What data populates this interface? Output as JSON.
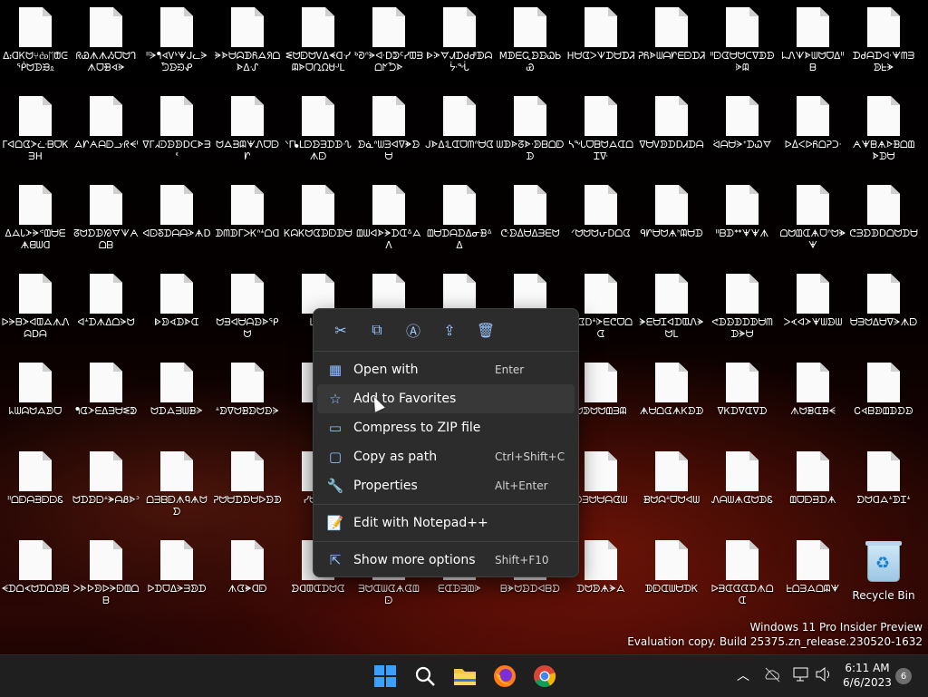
{
  "desktop": {
    "files": [
      [
        "ᐃ᎓ᗡᏦᗢ⑂ᦺᦈᛖᙧᕮᖀᗢᗬᙑᦸ",
        "ᖇᏯᗑᗑᏱᗜᗢᒉᗑᗜᙩᗏᗓ",
        "ᐦᗒᖳᗏᏙᔉᗖᒍᓚᗔᘫᗦᙌᕵ",
        "ᗓᗍᗨᗣᗫᏲᗋᖆᗝᗍᐃᔙ",
        "ᓬᗢᗟᗢᏙᐃᗛᗡᓺᗼᗎᗜᘩᘯᏌᒢᒪ",
        "ᒃᘑᐢᗓᐚᗞᕲᑦᓯᗵᗲᗝᖼᘪᗍ",
        "ᐈᗈᗊᗂᗪᑯᒇᗫᗣᔼᖔ",
        "MᗫᗴᏩᗦᗦᏇᏏᏯ",
        "HᗨᗧᐳᗐᗪᗨᗪᏘ",
        "ᕈᏲᗎᗯᗩᗁᗴᗠᗪᏘ",
        "ᐦᗠᗧᗨᗢᑕᐁᗫᗦᗇᗼ",
        "ᖺᏁᗐᗍᗯᗢᗜᐃᐦᗷ",
        "ᗪᑰᗩᗪᐚᗖᗰᗱᗥᖶᗘ"
      ],
      [
        "ᒦᐊᗝᗧᗆᓩᗷᗜᏦᗱH",
        "ᗋᗁᗅᗩᗟᓣᖇᗕᑊ",
        "ᐁᒥᖽᑓᗦᗥᗞᑕᗍᗱᓫ",
        "ᗢᗋᗲᗼᗖᏁᗜᗠᗁ",
        "ᐠᒥᖲᒪᗠᗦᗳᗪᗬᔗᗑᗠ",
        "ᗦᓈᐢᗯᗳᐊᐁᗙᗦᗨ",
        "ᒍᗍᐃᒺᗭᗜᗰᐢᗨᗧ",
        "ᗯᗫᗎᘔᗍᐧᗥᗹᗝᗟᗬ",
        "ᓵᖔᗜᗷᗢᗋᗭᗝᏆᐍ",
        "ᐁᗨᏙᗥᗪᗞᏗᗪᗩ",
        "ᐛᗩᗨᗔᕀᗪᏇᗊ",
        "ᐅᐂᐸᐅᏲᗝᕉᑐᐧ",
        "ᗅᗖᗸᗗᗌᗿᗝᗶᗍᗬᗨ"
      ],
      [
        "ᐃᗋᏓᗆᗓᕝᗶᗨᗴᗗᗺᗯᗡ",
        "ᘔᗢᗤᗬᘞᗊᗐᗅᗝᗹ",
        "ᐊᗠᘕᗪᗩᗩᗈᗗᗞ",
        "ᗫᗰᗫᒥᐳᏦᐢᗮᗝᗡ",
        "ᏦᗣᏦᗢᗧᗬᗟᗫᗨ",
        "ᗶᗯᐊᗍᗘᗪᗭᐞᗋᐱ",
        "ᗶᗨᗪᗩᗤᐃᓂᗽᐞᐃ",
        "ᕩᗦᐂᗨᐃᗱᗴᗢ",
        "ᐟᗢᗢᗢᕂᗞᗝᗧ",
        "ᑫᗁᗨᗢᗗᑋᗼᗨᗬ",
        "ᐦᗷᗫᕯᗖᗖᗑ",
        "ᗝᗢᗶᗭᗗᗜᐢᗢᗙᗖ",
        "ᕦᗱᗤᗫᗞᗝᗢᗪᗨ"
      ],
      [
        "ᐅᗒᗷᗆᐊᗵᗋᗑᏁᗣᗞᗩ",
        "ᐊᗮᗪᗑᐃᗝᗔᗢ",
        "ᐈᗥᗏᗬᗍᗭ",
        "ᗢᗲᐊᗨᗩᗦᗎᕿᗢ",
        "ᒪᒥᗶ",
        "",
        "",
        "",
        "ᗪᗧᗞᗮᗇᗴᕦᗜᗝᗧ",
        "ᗚᗴᗨᏆᐊᗪᗵᏁᗘᗢᒪ",
        "ᕙᗬᗦᗫᗪᗫᗨᗰᗬᗘᗨ",
        "ᐳᗉᐊᗆᗖᗯᗦᗯ",
        "ᗨᗱᗢᐃᗨᐁᗔᗑᗠ"
      ],
      [
        "ᖾᗯᗣᗢᗋᗥᗜ",
        "ᖳᗧᗆᗴᐃᗳᗨᓬᕲ",
        "ᗢᗪᗋᗱᗯᗽᗈ",
        "ᗮᗦᐁᗢᗽᗦᗢᗦᗔ",
        "",
        "",
        "",
        "",
        "ᗢᕲᗢᗢᗶᗳᗼ",
        "ᗗᗨᗝᗧᗗᏦᗦᗫ",
        "ᐁᏦᗪᐁᗭᐁᗪ",
        "ᗑᗢᗾᗭᗽᗕ",
        "Ꮯᗏᗷᗥᗶᗬᗤᗦ"
      ],
      [
        "ᐦᗝᗟᗩᗲᗟᗠᏋ",
        "ᗢᗪᗦᗠᗮᗘᗩᏰᗍᐣ",
        "ᗝᗱᗹᗟᗑᏄᗗᗢᗤ",
        "ᕉᗢᗨᗪᗦᗨᐅᗦᗫ",
        "ᓯᗨᗟᕵ",
        "",
        "",
        "",
        "ᗫᗳᗢᗨᗩᗧᗯ",
        "ᗽᗢᗣᗮᗜᗢᐊᗯ",
        "ᏁᗩᗯᗗᗧᗢᗫᏋ",
        "ᗶᗜᗟᗲᗪᗗ",
        "ᗤᗢᗡᗋᗮᗫᏆᗮ"
      ],
      [
        "ᗕᗪᗝᗉᗢᗪᗝᗦᗷ",
        "ᐳᗍᐅᗥᐅᗔᗟᗶᗝᗷ",
        "ᐅᗪᗜᐃᗒᗳᗥᗪ",
        "ᗑᗧᗙᗡᗟ",
        "ᗦᗡᗵᗭᗪᗢᗧ",
        "ᗱᗢᗭᗯᗧᗗᗧᗶᗠ",
        "ᗴᗭᗬᗳᗶᗇ",
        "ᗷᗘᗢᗦᗪᐊᗷᗤ",
        "ᗪᗢᗥᗗᗘᗋ",
        "ᗫᗟᗭᗯᗨᗪᏦ",
        "ᐅᗲᗭᗧᗧᗪᗑᗝᗭ",
        "ᖶᗝᗳᗋᗝᗼᗖ",
        ""
      ]
    ],
    "recycle_label": "Recycle Bin"
  },
  "watermark": {
    "line1": "Windows 11 Pro Insider Preview",
    "line2": "Evaluation copy. Build 25375.zn_release.230520-1632"
  },
  "context_menu": {
    "toolbar": [
      {
        "name": "cut-icon",
        "glyph": "✂"
      },
      {
        "name": "copy-icon",
        "glyph": "⧉"
      },
      {
        "name": "rename-icon",
        "glyph": "Ⓐ"
      },
      {
        "name": "share-icon",
        "glyph": "⇪"
      },
      {
        "name": "delete-icon",
        "glyph": "🗑"
      }
    ],
    "items": [
      {
        "label": "Open with",
        "accel": "Enter",
        "icon": "▦"
      },
      {
        "label": "Add to Favorites",
        "accel": "",
        "icon": "☆"
      },
      {
        "label": "Compress to ZIP file",
        "accel": "",
        "icon": "▭"
      },
      {
        "label": "Copy as path",
        "accel": "Ctrl+Shift+C",
        "icon": "▢"
      },
      {
        "label": "Properties",
        "accel": "Alt+Enter",
        "icon": "🔧"
      },
      {
        "label": "Edit with Notepad++",
        "accel": "",
        "icon": "📝"
      },
      {
        "label": "Show more options",
        "accel": "Shift+F10",
        "icon": "⇱"
      }
    ]
  },
  "taskbar": {
    "time": "6:11 AM",
    "date": "6/6/2023",
    "notifications": "6"
  }
}
